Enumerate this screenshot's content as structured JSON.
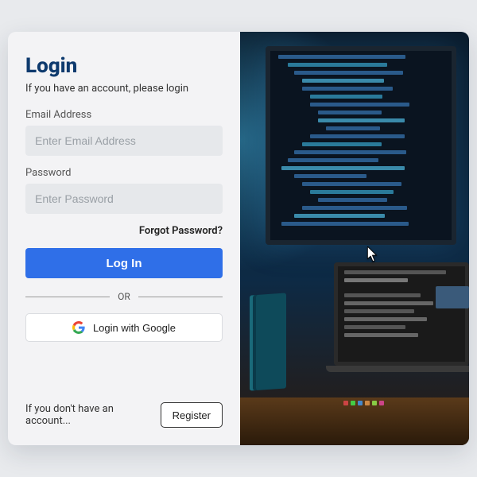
{
  "login": {
    "title": "Login",
    "subtitle": "If you have an account, please login",
    "email_label": "Email Address",
    "email_placeholder": "Enter Email Address",
    "password_label": "Password",
    "password_placeholder": "Enter Password",
    "forgot": "Forgot Password?",
    "login_btn": "Log In",
    "or": "OR",
    "google_btn": "Login with Google",
    "no_account_text": "If you don't have an account...",
    "register_btn": "Register"
  }
}
